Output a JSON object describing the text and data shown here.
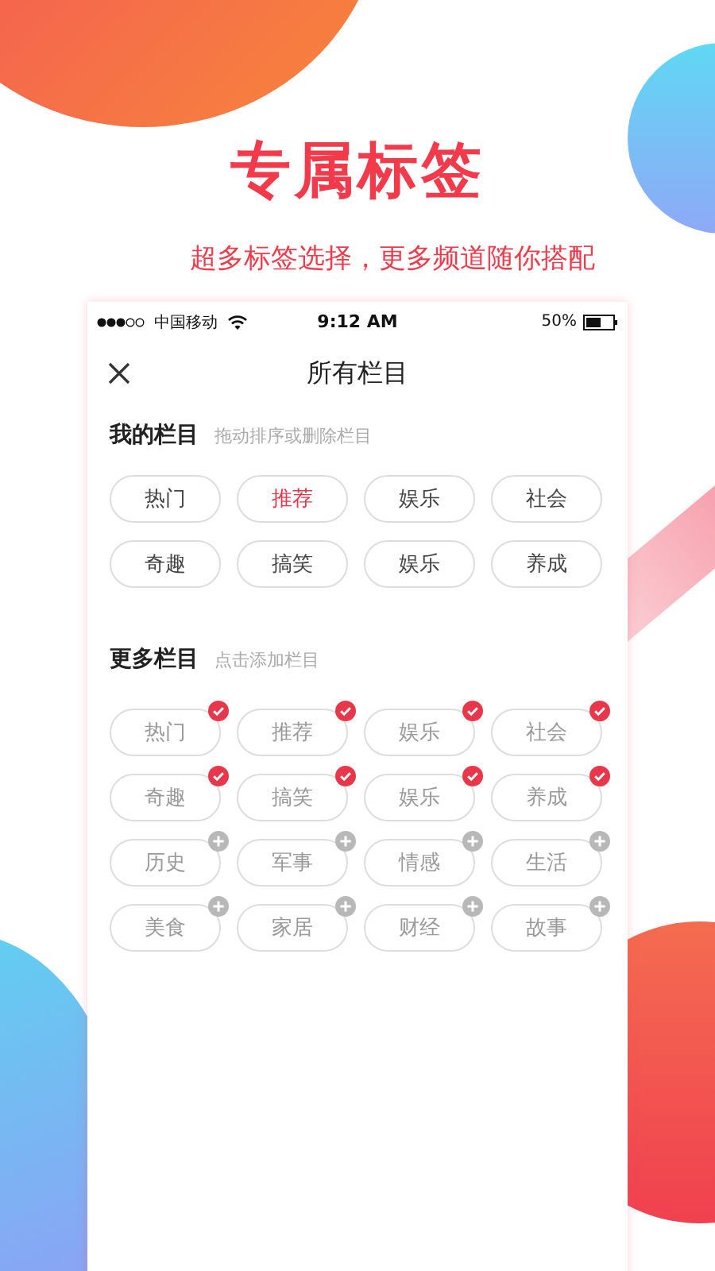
{
  "promo": {
    "title": "专属标签",
    "subtitle": "超多标签选择，更多频道随你搭配"
  },
  "status_bar": {
    "carrier": "中国移动",
    "time": "9:12 AM",
    "battery": "50%"
  },
  "header": {
    "title": "所有栏目"
  },
  "my_channels": {
    "title": "我的栏目",
    "hint": "拖动排序或删除栏目",
    "tags": [
      {
        "label": "热门",
        "selected": false
      },
      {
        "label": "推荐",
        "selected": true
      },
      {
        "label": "娱乐",
        "selected": false
      },
      {
        "label": "社会",
        "selected": false
      },
      {
        "label": "奇趣",
        "selected": false
      },
      {
        "label": "搞笑",
        "selected": false
      },
      {
        "label": "娱乐",
        "selected": false
      },
      {
        "label": "养成",
        "selected": false
      }
    ]
  },
  "more_channels": {
    "title": "更多栏目",
    "hint": "点击添加栏目",
    "tags": [
      {
        "label": "热门",
        "added": true
      },
      {
        "label": "推荐",
        "added": true
      },
      {
        "label": "娱乐",
        "added": true
      },
      {
        "label": "社会",
        "added": true
      },
      {
        "label": "奇趣",
        "added": true
      },
      {
        "label": "搞笑",
        "added": true
      },
      {
        "label": "娱乐",
        "added": true
      },
      {
        "label": "养成",
        "added": true
      },
      {
        "label": "历史",
        "added": false
      },
      {
        "label": "军事",
        "added": false
      },
      {
        "label": "情感",
        "added": false
      },
      {
        "label": "生活",
        "added": false
      },
      {
        "label": "美食",
        "added": false
      },
      {
        "label": "家居",
        "added": false
      },
      {
        "label": "财经",
        "added": false
      },
      {
        "label": "故事",
        "added": false
      }
    ]
  }
}
